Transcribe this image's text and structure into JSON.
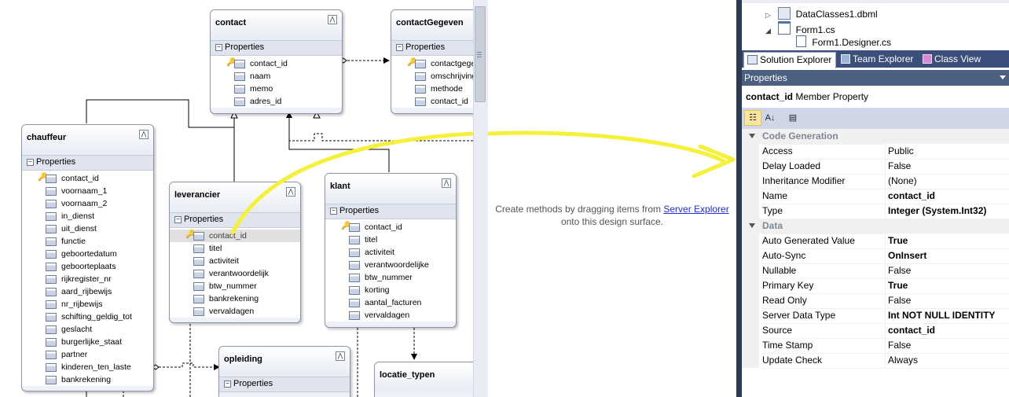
{
  "entities": [
    {
      "id": "contact",
      "title": "contact",
      "section": "Properties",
      "collapse_glyph": "⋀",
      "rows": [
        {
          "key": true,
          "name": "contact_id"
        },
        {
          "name": "naam"
        },
        {
          "name": "memo"
        },
        {
          "name": "adres_id"
        }
      ]
    },
    {
      "id": "contactgegeven",
      "title": "contactGegeven",
      "section": "Properties",
      "collapse_glyph": "⋀",
      "rows": [
        {
          "key": true,
          "name": "contactgege"
        },
        {
          "name": "omschrijving"
        },
        {
          "name": "methode"
        },
        {
          "name": "contact_id"
        }
      ]
    },
    {
      "id": "chauffeur",
      "title": "chauffeur",
      "section": "Properties",
      "collapse_glyph": "⋀",
      "rows": [
        {
          "key": true,
          "name": "contact_id"
        },
        {
          "name": "voornaam_1"
        },
        {
          "name": "voornaam_2"
        },
        {
          "name": "in_dienst"
        },
        {
          "name": "uit_dienst"
        },
        {
          "name": "functie"
        },
        {
          "name": "geboortedatum"
        },
        {
          "name": "geboorteplaats"
        },
        {
          "name": "rijkregister_nr"
        },
        {
          "name": "aard_rijbewijs"
        },
        {
          "name": "nr_rijbewijs"
        },
        {
          "name": "schifting_geldig_tot"
        },
        {
          "name": "geslacht"
        },
        {
          "name": "burgerlijke_staat"
        },
        {
          "name": "partner"
        },
        {
          "name": "kinderen_ten_laste"
        },
        {
          "name": "bankrekening"
        }
      ]
    },
    {
      "id": "leverancier",
      "title": "leverancier",
      "section": "Properties",
      "collapse_glyph": "⋀",
      "rows": [
        {
          "key": true,
          "name": "contact_id",
          "selected": true
        },
        {
          "name": "titel"
        },
        {
          "name": "activiteit"
        },
        {
          "name": "verantwoordelijk"
        },
        {
          "name": "btw_nummer"
        },
        {
          "name": "bankrekening"
        },
        {
          "name": "vervaldagen"
        }
      ]
    },
    {
      "id": "klant",
      "title": "klant",
      "section": "Properties",
      "collapse_glyph": "⋀",
      "rows": [
        {
          "key": true,
          "name": "contact_id"
        },
        {
          "name": "titel"
        },
        {
          "name": "activiteit"
        },
        {
          "name": "verantwoordelijke"
        },
        {
          "name": "btw_nummer"
        },
        {
          "name": "korting"
        },
        {
          "name": "aantal_facturen"
        },
        {
          "name": "vervaldagen"
        }
      ]
    },
    {
      "id": "opleiding",
      "title": "opleiding",
      "section": "Properties",
      "collapse_glyph": "⋀",
      "rows": []
    },
    {
      "id": "locatie_typen",
      "title": "locatie_typen",
      "section": "",
      "collapse_glyph": "",
      "rows": []
    }
  ],
  "methods_pane": {
    "message_before": "Create methods by dragging items from ",
    "link": "Server Explorer",
    "message_after": "onto this design surface."
  },
  "solution_tree": [
    {
      "label": "DataClasses1.dbml",
      "icon": "dbml-icon",
      "expander": "▷"
    },
    {
      "label": "Form1.cs",
      "icon": "form-icon",
      "expander": "◢"
    },
    {
      "label": "Form1.Designer.cs",
      "icon": "cs-file-icon",
      "expander": ""
    }
  ],
  "tabs": [
    {
      "label": "Solution Explorer",
      "active": true,
      "icon": "solution-explorer-icon"
    },
    {
      "label": "Team Explorer",
      "active": false,
      "icon": "team-explorer-icon"
    },
    {
      "label": "Class View",
      "active": false,
      "icon": "class-view-icon"
    }
  ],
  "properties": {
    "title": "Properties",
    "selected_object_name": "contact_id",
    "selected_object_type": "Member Property",
    "categories": [
      {
        "name": "Code Generation",
        "items": [
          {
            "name": "Access",
            "value": "Public",
            "bold": false
          },
          {
            "name": "Delay Loaded",
            "value": "False",
            "bold": false
          },
          {
            "name": "Inheritance Modifier",
            "value": "(None)",
            "bold": false
          },
          {
            "name": "Name",
            "value": "contact_id",
            "bold": true
          },
          {
            "name": "Type",
            "value": "Integer (System.Int32)",
            "bold": true
          }
        ]
      },
      {
        "name": "Data",
        "items": [
          {
            "name": "Auto Generated Value",
            "value": "True",
            "bold": true
          },
          {
            "name": "Auto-Sync",
            "value": "OnInsert",
            "bold": true
          },
          {
            "name": "Nullable",
            "value": "False",
            "bold": false
          },
          {
            "name": "Primary Key",
            "value": "True",
            "bold": true
          },
          {
            "name": "Read Only",
            "value": "False",
            "bold": false
          },
          {
            "name": "Server Data Type",
            "value": "Int NOT NULL IDENTITY",
            "bold": true
          },
          {
            "name": "Source",
            "value": "contact_id",
            "bold": true
          },
          {
            "name": "Time Stamp",
            "value": "False",
            "bold": false
          },
          {
            "name": "Update Check",
            "value": "Always",
            "bold": false
          }
        ]
      }
    ]
  },
  "colors": {
    "annotation": "#f5f03a",
    "panel_dark": "#2b3a55",
    "link": "#1e2ee0"
  }
}
